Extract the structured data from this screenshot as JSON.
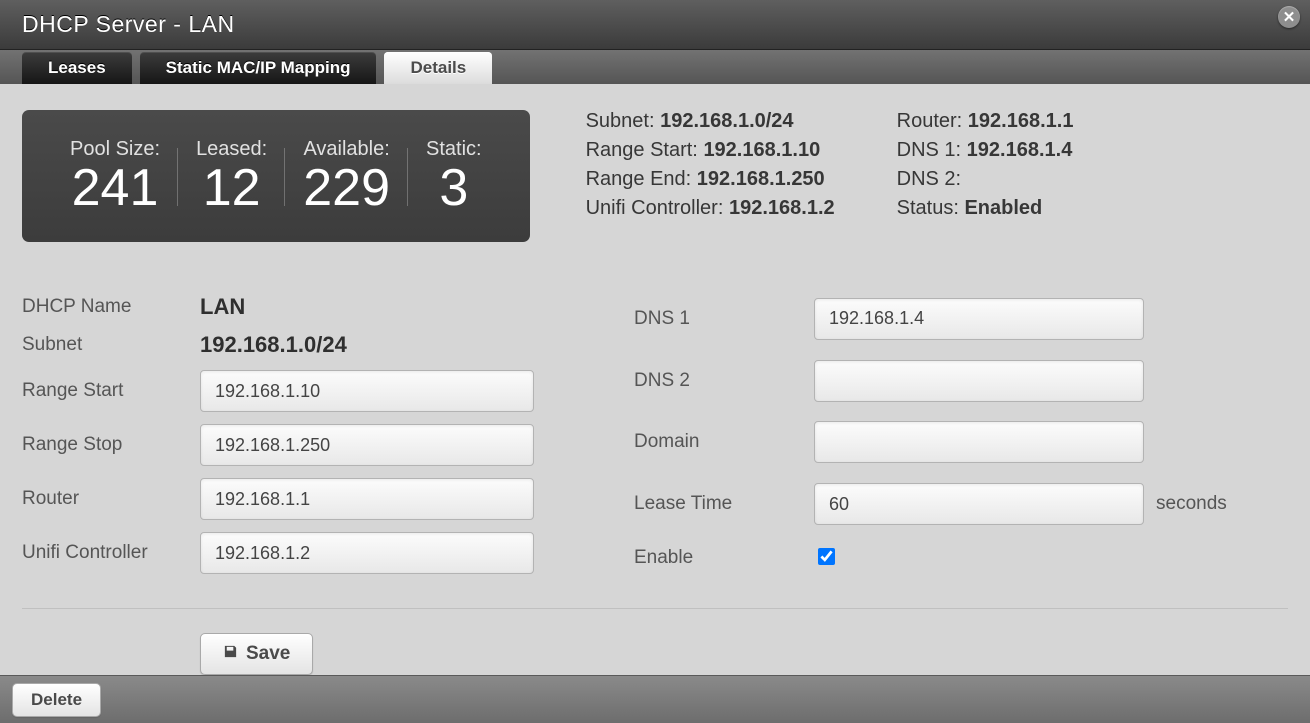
{
  "window": {
    "title": "DHCP Server - LAN"
  },
  "tabs": [
    {
      "label": "Leases"
    },
    {
      "label": "Static MAC/IP Mapping"
    },
    {
      "label": "Details"
    }
  ],
  "active_tab": 2,
  "stats": {
    "pool_size": {
      "label": "Pool Size:",
      "value": "241"
    },
    "leased": {
      "label": "Leased:",
      "value": "12"
    },
    "available": {
      "label": "Available:",
      "value": "229"
    },
    "static": {
      "label": "Static:",
      "value": "3"
    }
  },
  "info_left": {
    "subnet": {
      "label": "Subnet:",
      "value": "192.168.1.0/24"
    },
    "range_start": {
      "label": "Range Start:",
      "value": "192.168.1.10"
    },
    "range_end": {
      "label": "Range End:",
      "value": "192.168.1.250"
    },
    "unifi": {
      "label": "Unifi Controller:",
      "value": "192.168.1.2"
    }
  },
  "info_right": {
    "router": {
      "label": "Router:",
      "value": "192.168.1.1"
    },
    "dns1": {
      "label": "DNS 1:",
      "value": "192.168.1.4"
    },
    "dns2": {
      "label": "DNS 2:",
      "value": ""
    },
    "status": {
      "label": "Status:",
      "value": "Enabled"
    }
  },
  "form": {
    "labels": {
      "dhcp_name": "DHCP Name",
      "subnet": "Subnet",
      "range_start": "Range Start",
      "range_stop": "Range Stop",
      "router": "Router",
      "unifi": "Unifi Controller",
      "dns1": "DNS 1",
      "dns2": "DNS 2",
      "domain": "Domain",
      "lease_time": "Lease Time",
      "enable": "Enable",
      "seconds": "seconds"
    },
    "values": {
      "dhcp_name": "LAN",
      "subnet": "192.168.1.0/24",
      "range_start": "192.168.1.10",
      "range_stop": "192.168.1.250",
      "router": "192.168.1.1",
      "unifi": "192.168.1.2",
      "dns1": "192.168.1.4",
      "dns2": "",
      "domain": "",
      "lease_time": "60",
      "enable": true
    }
  },
  "buttons": {
    "save": "Save",
    "delete": "Delete"
  }
}
